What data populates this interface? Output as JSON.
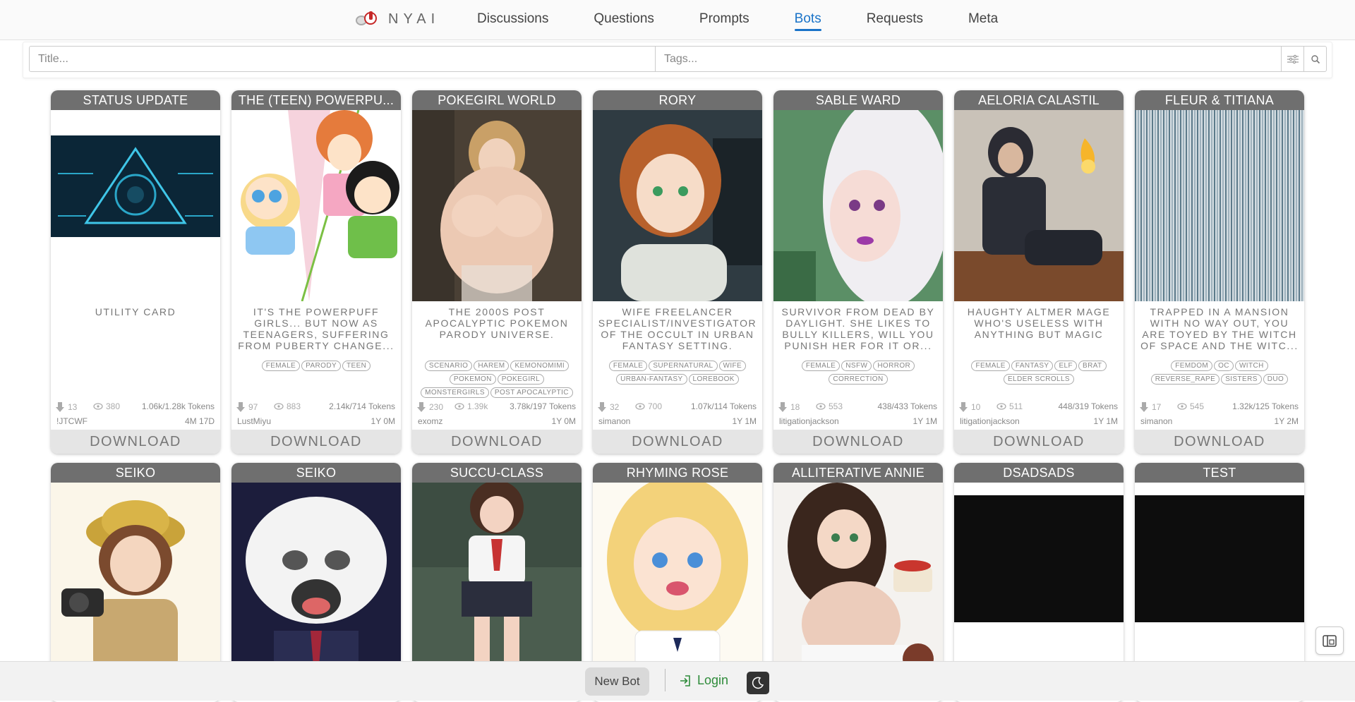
{
  "app": {
    "logo_text": "NYAI"
  },
  "nav": [
    {
      "label": "Discussions",
      "active": false
    },
    {
      "label": "Questions",
      "active": false
    },
    {
      "label": "Prompts",
      "active": false
    },
    {
      "label": "Bots",
      "active": true
    },
    {
      "label": "Requests",
      "active": false
    },
    {
      "label": "Meta",
      "active": false
    }
  ],
  "search": {
    "title_placeholder": "Title...",
    "tags_placeholder": "Tags..."
  },
  "cards_row1": [
    {
      "title": "STATUS UPDATE",
      "art": "hud-triangle",
      "description": "UTILITY CARD",
      "tags": [],
      "downloads": "13",
      "views": "380",
      "tokens": "1.06k/1.28k Tokens",
      "author": "!JTCWF",
      "age": "4M 17D"
    },
    {
      "title": "THE (TEEN) POWERPU...",
      "art": "cartoon-girls",
      "description": "IT'S THE POWERPUFF GIRLS... BUT NOW AS TEENAGERS, SUFFERING FROM PUBERTY CHANGE...",
      "tags": [
        "FEMALE",
        "PARODY",
        "TEEN"
      ],
      "downloads": "97",
      "views": "883",
      "tokens": "2.14k/714 Tokens",
      "author": "LustMiyu",
      "age": "1Y 0M"
    },
    {
      "title": "POKEGIRL WORLD",
      "art": "figure-warm",
      "description": "THE 2000S POST APOCALYPTIC POKEMON PARODY UNIVERSE.",
      "tags": [
        "SCENARIO",
        "HAREM",
        "KEMONOMIMI",
        "POKEMON",
        "POKEGIRL",
        "MONSTERGIRLS",
        "POST APOCALYPTIC"
      ],
      "downloads": "230",
      "views": "1.39k",
      "tokens": "3.78k/197 Tokens",
      "author": "exomz",
      "age": "1Y 0M"
    },
    {
      "title": "RORY",
      "art": "portrait-red-hair",
      "description": "WIFE FREELANCER SPECIALIST/INVESTIGATOR OF THE OCCULT IN URBAN FANTASY SETTING.",
      "tags": [
        "FEMALE",
        "SUPERNATURAL",
        "WIFE",
        "URBAN-FANTASY",
        "LOREBOOK"
      ],
      "downloads": "32",
      "views": "700",
      "tokens": "1.07k/114 Tokens",
      "author": "simanon",
      "age": "1Y 1M"
    },
    {
      "title": "SABLE WARD",
      "art": "portrait-white-hair",
      "description": "SURVIVOR FROM DEAD BY DAYLIGHT. SHE LIKES TO BULLY KILLERS, WILL YOU PUNISH HER FOR IT OR...",
      "tags": [
        "FEMALE",
        "NSFW",
        "HORROR",
        "CORRECTION"
      ],
      "downloads": "18",
      "views": "553",
      "tokens": "438/433 Tokens",
      "author": "litigationjackson",
      "age": "1Y 1M"
    },
    {
      "title": "AELORIA CALASTIL",
      "art": "portrait-dark-mage",
      "description": "HAUGHTY ALTMER MAGE WHO'S USELESS WITH ANYTHING BUT MAGIC",
      "tags": [
        "FEMALE",
        "FANTASY",
        "ELF",
        "BRAT",
        "ELDER SCROLLS"
      ],
      "downloads": "10",
      "views": "511",
      "tokens": "448/319 Tokens",
      "author": "litigationjackson",
      "age": "1Y 1M"
    },
    {
      "title": "FLEUR & TITIANA",
      "art": "stripes",
      "description": "TRAPPED IN A MANSION WITH NO WAY OUT, YOU ARE TOYED BY THE WITCH OF SPACE AND THE WITC...",
      "tags": [
        "FEMDOM",
        "OC",
        "WITCH",
        "REVERSE_RAPE",
        "SISTERS",
        "DUO"
      ],
      "downloads": "17",
      "views": "545",
      "tokens": "1.32k/125 Tokens",
      "author": "simanon",
      "age": "1Y 2M"
    }
  ],
  "cards_row2": [
    {
      "title": "SEIKO",
      "art": "explorer-girl"
    },
    {
      "title": "SEIKO",
      "art": "cartoon-white"
    },
    {
      "title": "SUCCU-CLASS",
      "art": "school-girl"
    },
    {
      "title": "RHYMING ROSE",
      "art": "blonde-girl"
    },
    {
      "title": "ALLITERATIVE ANNIE",
      "art": "maid-cake"
    },
    {
      "title": "DSADSADS",
      "art": "black"
    },
    {
      "title": "TEST",
      "art": "black"
    }
  ],
  "labels": {
    "download": "DOWNLOAD"
  },
  "bottom": {
    "new_bot": "New Bot",
    "login": "Login"
  },
  "colors": {
    "accent": "#1a73c8",
    "login_green": "#2e8b3a",
    "title_bar": "#6f6f6f"
  }
}
